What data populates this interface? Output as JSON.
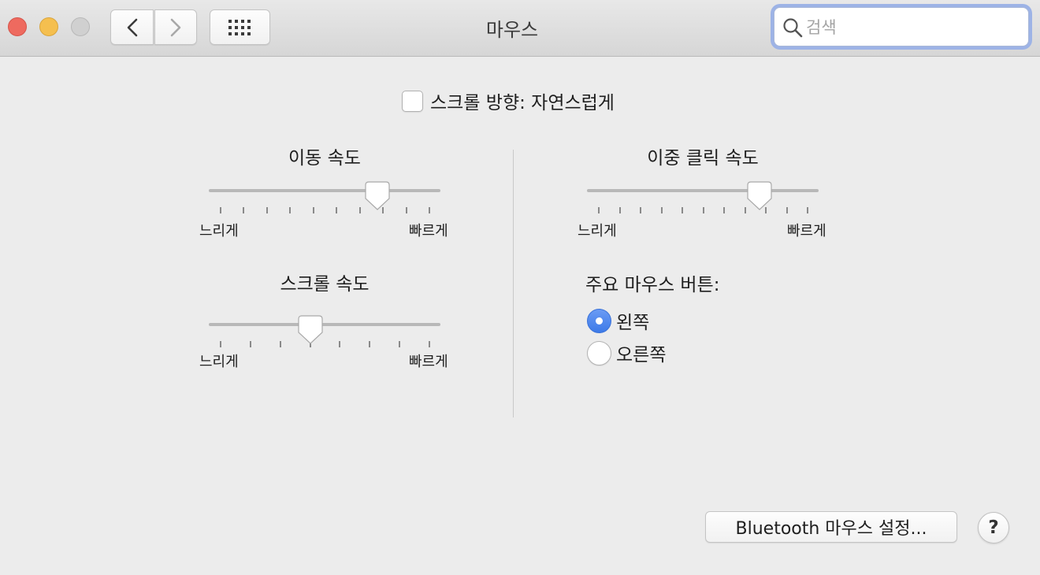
{
  "window": {
    "title": "마우스"
  },
  "search": {
    "placeholder": "검색",
    "value": ""
  },
  "scroll_direction": {
    "label": "스크롤 방향: 자연스럽게",
    "checked": false
  },
  "tracking_speed": {
    "title": "이동 속도",
    "min_label": "느리게",
    "max_label": "빠르게",
    "ticks": 10,
    "value_fraction": 0.75
  },
  "scroll_speed": {
    "title": "스크롤 속도",
    "min_label": "느리게",
    "max_label": "빠르게",
    "ticks": 8,
    "value_fraction": 0.43
  },
  "double_click_speed": {
    "title": "이중 클릭 속도",
    "min_label": "느리게",
    "max_label": "빠르게",
    "ticks": 11,
    "value_fraction": 0.77
  },
  "primary_button": {
    "title": "주요 마우스 버튼:",
    "options": [
      {
        "label": "왼쪽",
        "selected": true
      },
      {
        "label": "오른쪽",
        "selected": false
      }
    ]
  },
  "bluetooth_button": {
    "label": "Bluetooth 마우스 설정..."
  },
  "help_button": {
    "label": "?"
  },
  "icons": {
    "back": "chevron-left-icon",
    "forward": "chevron-right-icon",
    "grid": "grid-icon",
    "search": "magnifier-icon"
  },
  "colors": {
    "close": "#ee6a5f",
    "minimize": "#f5bf4f",
    "zoom": "#d0d0d0",
    "accent": "#3d7ae8",
    "focus_ring": "#9db3e6"
  }
}
